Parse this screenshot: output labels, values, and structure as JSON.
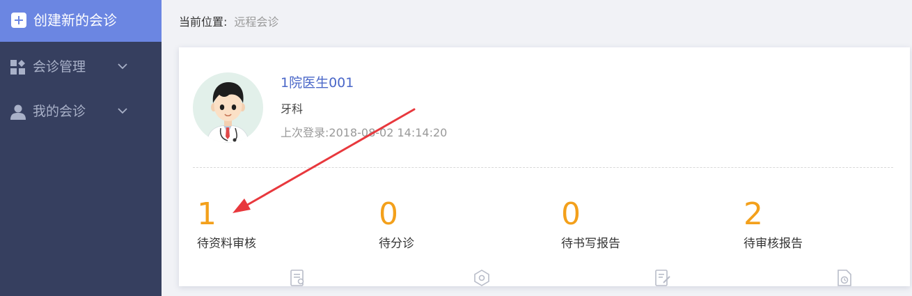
{
  "sidebar": {
    "create_label": "创建新的会诊",
    "items": [
      {
        "label": "会诊管理"
      },
      {
        "label": "我的会诊"
      }
    ]
  },
  "breadcrumb": {
    "label": "当前位置:",
    "current": "远程会诊"
  },
  "user": {
    "name": "1院医生001",
    "department": "牙科",
    "last_login": "上次登录:2018-08-02 14:14:20"
  },
  "stats": [
    {
      "value": "1",
      "label": "待资料审核",
      "icon": "document-review-icon"
    },
    {
      "value": "0",
      "label": "待分诊",
      "icon": "triage-icon"
    },
    {
      "value": "0",
      "label": "待书写报告",
      "icon": "write-report-icon"
    },
    {
      "value": "2",
      "label": "待审核报告",
      "icon": "review-report-icon"
    }
  ],
  "colors": {
    "sidebar_bg": "#363f5f",
    "accent": "#6b86e2",
    "stat_number": "#f3a01b",
    "user_name": "#4a67c8",
    "annotation_arrow": "#e8383d"
  }
}
